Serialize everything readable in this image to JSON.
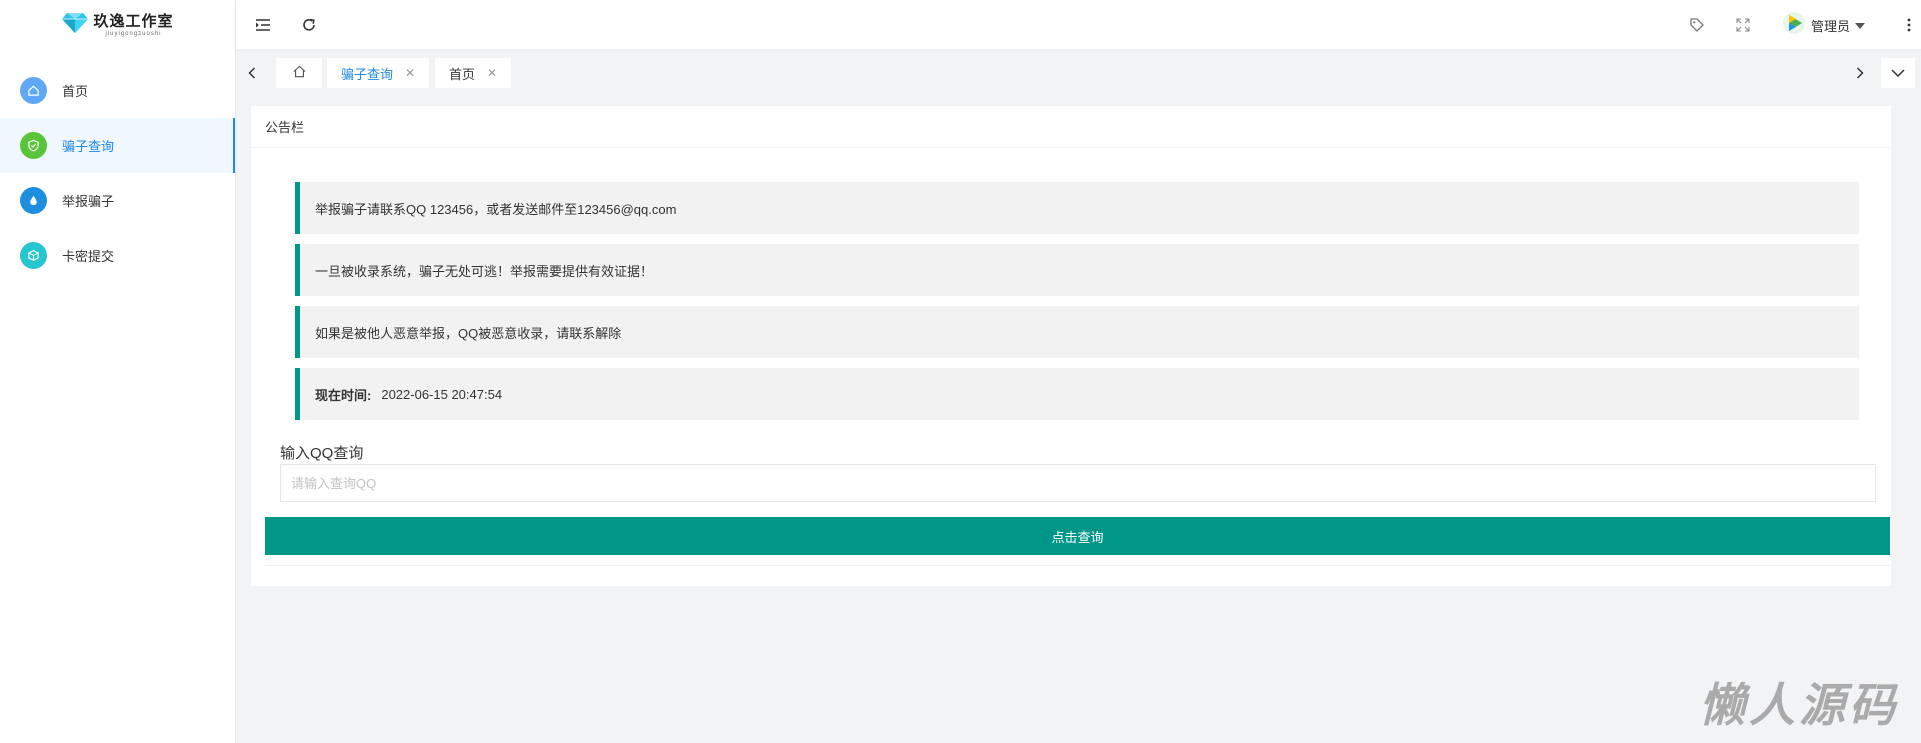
{
  "app": {
    "logo_title": "玖逸工作室",
    "logo_sub": "jiuyigongzuoshi"
  },
  "sidebar": {
    "items": [
      {
        "label": "首页",
        "icon": "home-icon",
        "color": "#5ea8f5"
      },
      {
        "label": "骗子查询",
        "icon": "shield-check-icon",
        "color": "#58c43a",
        "active": true
      },
      {
        "label": "举报骗子",
        "icon": "drop-icon",
        "color": "#1e8ee0"
      },
      {
        "label": "卡密提交",
        "icon": "cube-icon",
        "color": "#26c6d0"
      }
    ]
  },
  "header": {
    "user_name": "管理员"
  },
  "tabs": [
    {
      "label": "骗子查询",
      "active": true
    },
    {
      "label": "首页",
      "active": false
    }
  ],
  "card": {
    "title": "公告栏",
    "notices": [
      {
        "text": "举报骗子请联系QQ 123456，或者发送邮件至123456@qq.com"
      },
      {
        "text": "一旦被收录系统，骗子无处可逃！举报需要提供有效证据！"
      },
      {
        "text": "如果是被他人恶意举报，QQ被恶意收录，请联系解除"
      }
    ],
    "time_label": "现在时间:",
    "time_value": "2022-06-15 20:47:54",
    "query_label": "输入QQ查询",
    "query_placeholder": "请输入查询QQ",
    "query_value": "",
    "query_button": "点击查询"
  },
  "watermark": "懒人源码",
  "colors": {
    "accent": "#009688",
    "active_blue": "#1e88e5"
  }
}
